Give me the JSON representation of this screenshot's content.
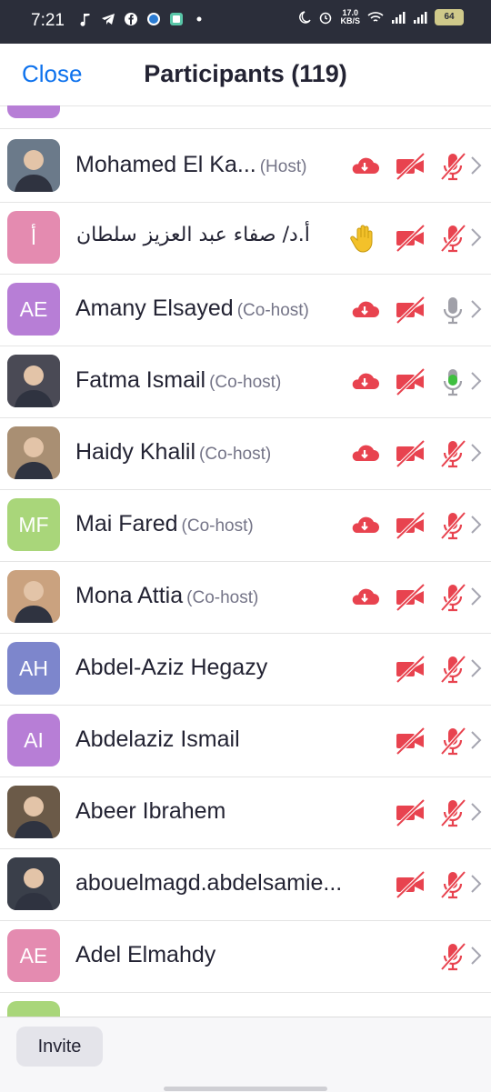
{
  "status_bar": {
    "time": "7:21",
    "net_speed": "17.0",
    "net_unit": "KB/S",
    "battery": "64"
  },
  "header": {
    "close_label": "Close",
    "title": "Participants (119)"
  },
  "participants": [
    {
      "name": "Mohamed El Ka...",
      "role": "(Host)",
      "avatar": "photo",
      "initials": "",
      "avatar_color": "#6b7a8a",
      "status": "cloud",
      "video_off": true,
      "mic": "muted"
    },
    {
      "name": "أ.د/ صفاء عبد العزيز سلطان",
      "role": "",
      "avatar": "initials",
      "initials": "أ",
      "avatar_color": "#e48bb0",
      "status": "raised-hand",
      "video_off": true,
      "mic": "muted"
    },
    {
      "name": "Amany Elsayed",
      "role": "(Co-host)",
      "avatar": "initials",
      "initials": "AE",
      "avatar_color": "#b77ed6",
      "status": "cloud",
      "video_off": true,
      "mic": "idle"
    },
    {
      "name": "Fatma Ismail",
      "role": "(Co-host)",
      "avatar": "photo",
      "initials": "",
      "avatar_color": "#4a4a55",
      "status": "cloud",
      "video_off": true,
      "mic": "speaking"
    },
    {
      "name": "Haidy Khalil",
      "role": "(Co-host)",
      "avatar": "photo",
      "initials": "",
      "avatar_color": "#a98f73",
      "status": "cloud",
      "video_off": true,
      "mic": "muted"
    },
    {
      "name": "Mai Fared",
      "role": "(Co-host)",
      "avatar": "initials",
      "initials": "MF",
      "avatar_color": "#a9d67a",
      "status": "cloud",
      "video_off": true,
      "mic": "muted"
    },
    {
      "name": "Mona Attia",
      "role": "(Co-host)",
      "avatar": "photo",
      "initials": "",
      "avatar_color": "#caa27f",
      "status": "cloud",
      "video_off": true,
      "mic": "muted"
    },
    {
      "name": "Abdel-Aziz Hegazy",
      "role": "",
      "avatar": "initials",
      "initials": "AH",
      "avatar_color": "#7d86cc",
      "status": "",
      "video_off": true,
      "mic": "muted"
    },
    {
      "name": "Abdelaziz Ismail",
      "role": "",
      "avatar": "initials",
      "initials": "AI",
      "avatar_color": "#b77ed6",
      "status": "",
      "video_off": true,
      "mic": "muted"
    },
    {
      "name": "Abeer Ibrahem",
      "role": "",
      "avatar": "photo",
      "initials": "",
      "avatar_color": "#6b5a48",
      "status": "",
      "video_off": true,
      "mic": "muted"
    },
    {
      "name": "abouelmagd.abdelsamie...",
      "role": "",
      "avatar": "photo",
      "initials": "",
      "avatar_color": "#3a3f4a",
      "status": "",
      "video_off": true,
      "mic": "muted"
    },
    {
      "name": "Adel Elmahdy",
      "role": "",
      "avatar": "initials",
      "initials": "AE",
      "avatar_color": "#e48bb0",
      "status": "",
      "video_off": false,
      "mic": "muted"
    }
  ],
  "footer": {
    "invite_label": "Invite"
  },
  "colors": {
    "accent": "#0e72ed",
    "muted_red": "#e8434f",
    "speaking_green": "#3fbf3f",
    "idle_gray": "#a0a0a8",
    "hand_yellow": "#f3c12a"
  }
}
